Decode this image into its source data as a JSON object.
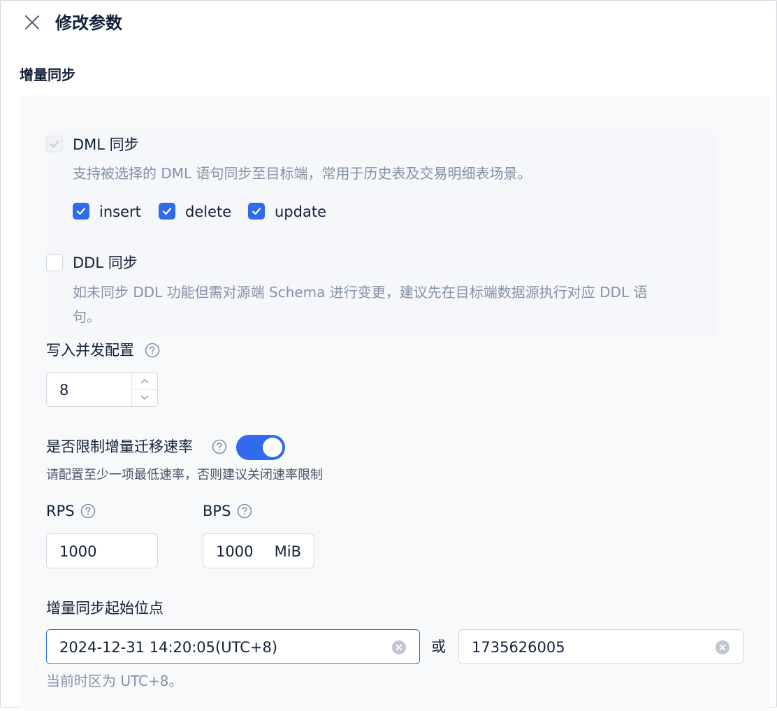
{
  "header": {
    "title": "修改参数",
    "close_icon": "close-icon"
  },
  "incremental_sync": {
    "section_title": "增量同步",
    "dml": {
      "label": "DML 同步",
      "checked": true,
      "disabled": true,
      "description": "支持被选择的 DML 语句同步至目标端，常用于历史表及交易明细表场景。",
      "options": [
        {
          "label": "insert",
          "checked": true
        },
        {
          "label": "delete",
          "checked": true
        },
        {
          "label": "update",
          "checked": true
        }
      ]
    },
    "ddl": {
      "label": "DDL 同步",
      "checked": false,
      "description_line1": "如未同步 DDL 功能但需对源端 Schema 进行变更，建议先在目标端数据源执行对应 DDL 语",
      "description_line2": "句。"
    },
    "write_concurrency": {
      "label": "写入并发配置",
      "value": "8"
    },
    "rate_limit": {
      "label": "是否限制增量迁移速率",
      "enabled": true,
      "hint": "请配置至少一项最低速率，否则建议关闭速率限制",
      "rps_label": "RPS",
      "rps_value": "1000",
      "bps_label": "BPS",
      "bps_value": "1000",
      "bps_unit": "MiB"
    },
    "start_position": {
      "label": "增量同步起始位点",
      "datetime_value": "2024-12-31 14:20:05(UTC+8)",
      "or_label": "或",
      "timestamp_value": "1735626005",
      "timezone_hint": "当前时区为 UTC+8。"
    }
  },
  "colors": {
    "accent": "#2f6bea",
    "text": "#132039",
    "muted": "#8591a6",
    "panel_bg": "#f8f9fb"
  }
}
